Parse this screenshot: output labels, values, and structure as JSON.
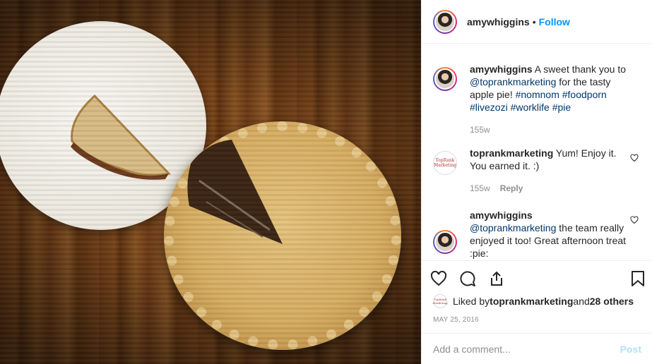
{
  "header": {
    "username": "amywhiggins",
    "separator": "•",
    "follow_label": "Follow"
  },
  "comments": [
    {
      "username": "amywhiggins",
      "text_before": " A sweet thank you to ",
      "mention": "@toprankmarketing",
      "text_after": " for the tasty apple pie! ",
      "hashtags": "#nomnom #foodporn #livezozi #worklife #pie",
      "time": "155w"
    },
    {
      "username": "toprankmarketing",
      "text": " Yum! Enjoy it. You earned it. :)",
      "time": "155w",
      "reply_label": "Reply",
      "avatar_text": "TopRank Marketing"
    },
    {
      "username": "amywhiggins",
      "mention": "@toprankmarketing",
      "text": " the team really enjoyed it too! Great afternoon treat :pie:"
    }
  ],
  "likes": {
    "prefix": "Liked by ",
    "user": "toprankmarketing",
    "middle": " and ",
    "others": "28 others"
  },
  "date": "MAY 25, 2016",
  "add_comment": {
    "placeholder": "Add a comment...",
    "post_label": "Post"
  },
  "icons": [
    "heart-icon",
    "comment-icon",
    "share-icon",
    "bookmark-icon"
  ],
  "colors": {
    "link_blue": "#0095f6",
    "mention": "#00376b",
    "muted": "#8e8e8e",
    "post_disabled": "#b2dffc"
  }
}
